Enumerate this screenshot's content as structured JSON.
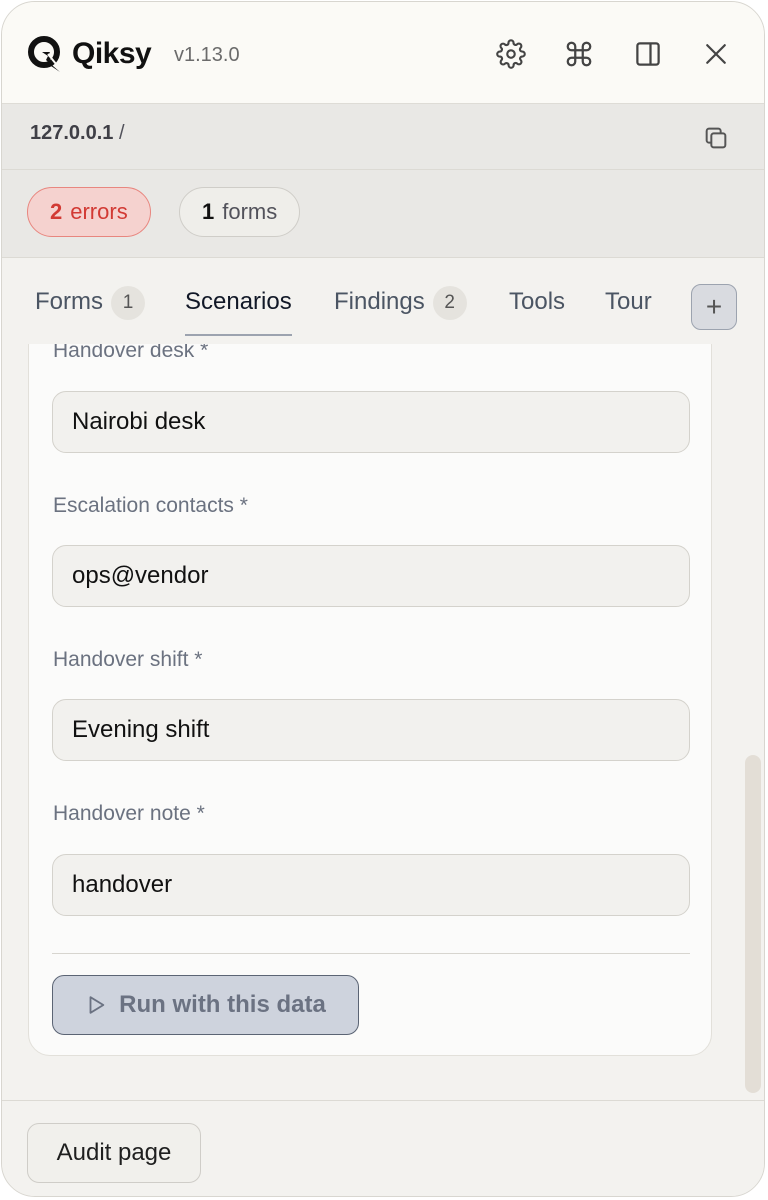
{
  "app": {
    "brand": "Qiksy",
    "version": "v1.13.0",
    "icons": [
      "settings-gear-icon",
      "command-icon",
      "sidebar-panel-icon",
      "close-icon"
    ]
  },
  "url": {
    "host": "127.0.0.1",
    "path": "/",
    "copy_icon": "copy-icon"
  },
  "badges": {
    "errors": {
      "count": "2",
      "label": "errors"
    },
    "forms": {
      "count": "1",
      "label": "forms"
    }
  },
  "tabs": [
    {
      "label": "Forms",
      "count": "1"
    },
    {
      "label": "Scenarios",
      "active": true
    },
    {
      "label": "Findings",
      "count": "2"
    },
    {
      "label": "Tools"
    },
    {
      "label": "Tour"
    }
  ],
  "add_tab_label": "+",
  "fields": [
    {
      "label": "Handover desk *",
      "value": "Nairobi desk"
    },
    {
      "label": "Escalation contacts *",
      "value": "ops@vendor"
    },
    {
      "label": "Handover shift *",
      "value": "Evening shift"
    },
    {
      "label": "Handover note *",
      "value": "handover"
    }
  ],
  "run_button": {
    "label": "Run with this data",
    "icon": "play-icon"
  },
  "footer": {
    "audit_label": "Audit page"
  },
  "colors": {
    "error_text": "#d23a34",
    "error_bg": "#f5d2cf",
    "run_bg": "#ced3dd"
  }
}
